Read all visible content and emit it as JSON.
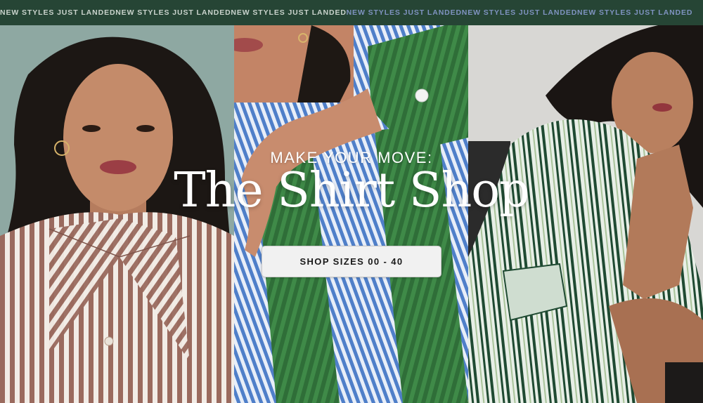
{
  "ticker": {
    "items": [
      {
        "text": "NEW STYLES JUST LANDED",
        "color": "#c9d3cc"
      },
      {
        "text": "NEW STYLES JUST LANDED",
        "color": "#c9d3cc"
      },
      {
        "text": "NEW STYLES JUST LANDED",
        "color": "#c9d3cc"
      },
      {
        "text": "NEW STYLES JUST LANDED",
        "color": "#7f93c0"
      },
      {
        "text": "NEW STYLES JUST LANDED",
        "color": "#7f93c0"
      },
      {
        "text": "NEW STYLES JUST LANDED",
        "color": "#7f93c0"
      }
    ],
    "background": "#264535"
  },
  "hero": {
    "eyebrow": "MAKE YOUR MOVE:",
    "title": "The Shirt Shop",
    "cta_label": "SHOP SIZES 00 - 40",
    "panels": [
      {
        "subject": "model in brown and white striped shirt",
        "stripe_color": "#9a6a5e"
      },
      {
        "subject": "close-up of green and blue striped shirt",
        "stripe_color": "#4f7fc9"
      },
      {
        "subject": "model in green and white striped shirt dress",
        "stripe_color": "#1f4a32"
      }
    ]
  }
}
